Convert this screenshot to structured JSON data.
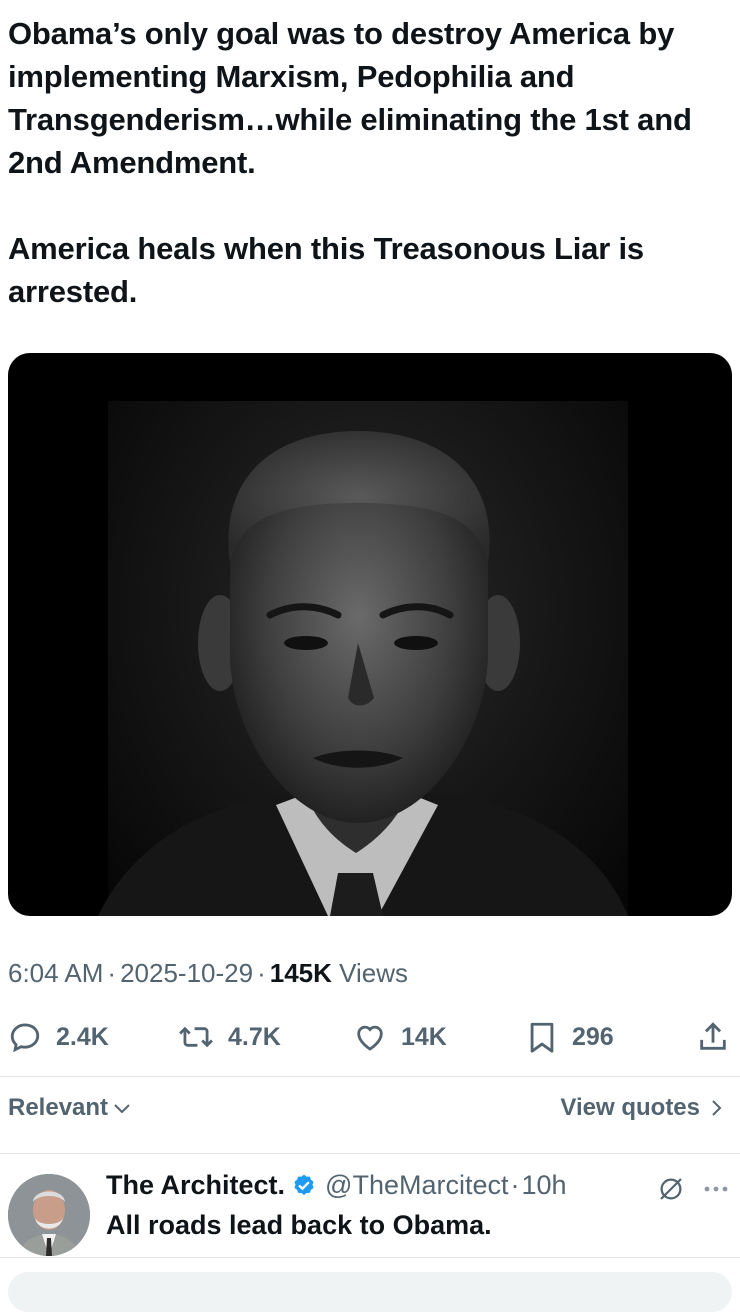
{
  "tweet": {
    "text_para1": "Obama’s only goal was to destroy America by implementing Marxism, Pedophilia and Transgenderism…while eliminating the 1st and 2nd Amendment.",
    "text_para2": "America heals when this Treasonous Liar is arrested."
  },
  "meta": {
    "time": "6:04 AM",
    "separator": "·",
    "date": "2025-10-29",
    "views_count": "145K",
    "views_label": "Views"
  },
  "actions": {
    "replies": "2.4K",
    "reposts": "4.7K",
    "likes": "14K",
    "bookmarks": "296"
  },
  "sort": {
    "label": "Relevant",
    "view_quotes": "View quotes"
  },
  "reply": {
    "name": "The Architect.",
    "handle": "@TheMarcitect",
    "separator": "·",
    "time": "10h",
    "text": "All roads lead back to Obama."
  },
  "icons": {
    "reply": "reply-icon",
    "repost": "repost-icon",
    "like": "heart-icon",
    "bookmark": "bookmark-icon",
    "share": "share-icon",
    "verified": "verified-badge-icon",
    "grok": "grok-icon",
    "more": "more-icon"
  },
  "colors": {
    "text": "#0f1419",
    "muted": "#536471",
    "verified": "#1d9bf0"
  }
}
